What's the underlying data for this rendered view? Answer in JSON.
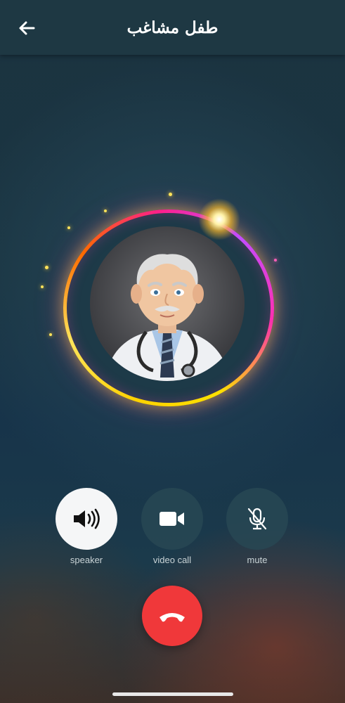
{
  "header": {
    "title": "طفل مشاغب",
    "back_icon": "arrow-left-icon"
  },
  "avatar": {
    "description_icon": "doctor-avatar"
  },
  "controls": [
    {
      "label": "speaker",
      "icon": "speaker-icon",
      "active": true
    },
    {
      "label": "video call",
      "icon": "video-camera-icon",
      "active": false
    },
    {
      "label": "mute",
      "icon": "microphone-muted-icon",
      "active": false
    }
  ],
  "end_call": {
    "icon": "phone-hangup-icon",
    "color": "#f0383a"
  },
  "colors": {
    "header_bg": "#1e3843",
    "ring_yellow": "#ffd200",
    "ring_pink": "#ff1f8a"
  }
}
